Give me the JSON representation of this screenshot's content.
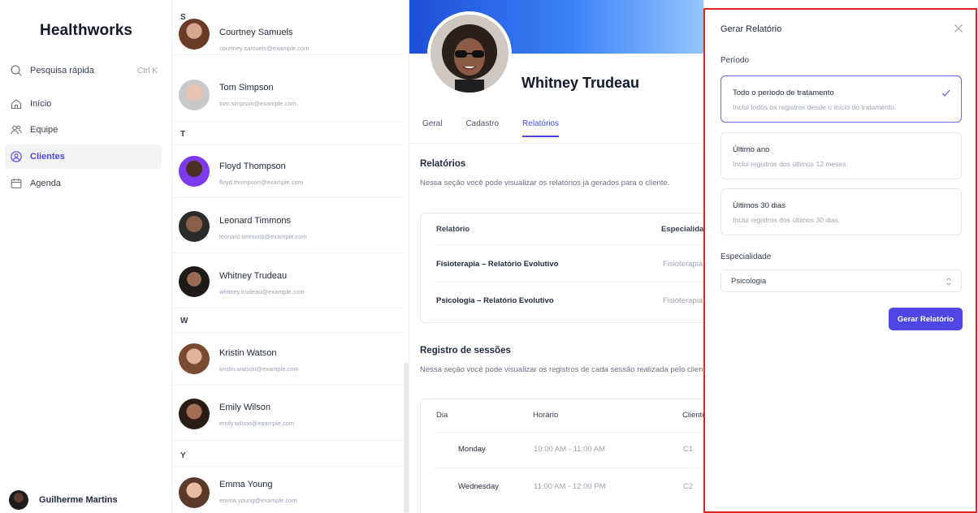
{
  "nav": {
    "brand": "Healthworks",
    "quick_search": {
      "label": "Pesquisa rápida",
      "shortcut": "Ctrl K"
    },
    "items": [
      {
        "label": "Início",
        "icon": "home-icon"
      },
      {
        "label": "Equipe",
        "icon": "users-icon"
      },
      {
        "label": "Clientes",
        "icon": "user-circle-icon",
        "active": true
      },
      {
        "label": "Agenda",
        "icon": "calendar-icon"
      }
    ],
    "user": {
      "name": "Guilherme Martins"
    }
  },
  "clients": {
    "letters": [
      "S",
      "T",
      "W",
      "Y"
    ],
    "rows": [
      {
        "name": "Courtney Samuels",
        "email": "courtney.samuels@example.com"
      },
      {
        "name": "Tom Simpson",
        "email": "tom.simpson@example.com"
      },
      {
        "name": "Floyd Thompson",
        "email": "floyd.thompson@example.com"
      },
      {
        "name": "Leonard Timmons",
        "email": "leonard.timmons@example.com"
      },
      {
        "name": "Whitney Trudeau",
        "email": "whitney.trudeau@example.com"
      },
      {
        "name": "Kristin Watson",
        "email": "kristin.watson@example.com"
      },
      {
        "name": "Emily Wilson",
        "email": "emily.wilson@example.com"
      },
      {
        "name": "Emma Young",
        "email": "emma.young@example.com"
      }
    ]
  },
  "detail": {
    "name": "Whitney Trudeau",
    "tabs": [
      "Geral",
      "Cadastro",
      "Relatórios"
    ],
    "reports": {
      "title": "Relatórios",
      "description": "Nessa seção você pode visualizar os relatórios já gerados para o cliente.",
      "headers": [
        "Relatório",
        "Especialidade"
      ],
      "rows": [
        [
          "Fisioterapia – Relatório Evolutivo",
          "Fisioterapia"
        ],
        [
          "Psicologia – Relatório Evolutivo",
          "Fisioterapia"
        ]
      ]
    },
    "sessions": {
      "title": "Registro de sessões",
      "description": "Nessa seção você pode visualizar os registros de cada sessão realizada pelo cliente.",
      "headers": [
        "Dia",
        "Horário",
        "Cliente"
      ],
      "rows": [
        [
          "Monday",
          "10:00 AM - 11:00 AM",
          "C1"
        ],
        [
          "Wednesday",
          "11:00 AM - 12:00 PM",
          "C2"
        ]
      ]
    }
  },
  "panel": {
    "title": "Gerar Relatório",
    "period_label": "Período",
    "options": [
      {
        "title": "Todo o período de tratamento",
        "desc": "Inclui todos os registros desde o início do tratamento.",
        "selected": true
      },
      {
        "title": "Último ano",
        "desc": "Inclui registros dos últimos 12 meses."
      },
      {
        "title": "Últimos 30 dias",
        "desc": "Inclui registros dos últimos 30 dias."
      }
    ],
    "specialty_label": "Especialidade",
    "specialty_value": "Psicologia",
    "submit": "Gerar Relatório"
  },
  "colors": {
    "accent": "#4f46e5",
    "highlight_border": "#dc2626"
  }
}
